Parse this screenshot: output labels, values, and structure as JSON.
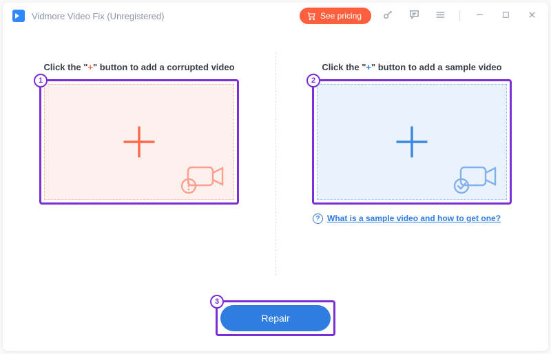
{
  "titlebar": {
    "title": "Vidmore Video Fix (Unregistered)",
    "see_pricing": "See pricing"
  },
  "steps": {
    "corrupted": {
      "badge": "1",
      "instruction_pre": "Click the \"",
      "instruction_plus": "+",
      "instruction_post": "\" button to add a corrupted video"
    },
    "sample": {
      "badge": "2",
      "instruction_pre": "Click the \"",
      "instruction_plus": "+",
      "instruction_post": "\" button to add a sample video",
      "help_text": "What is a sample video and how to get one?"
    },
    "repair": {
      "badge": "3",
      "label": "Repair"
    }
  }
}
